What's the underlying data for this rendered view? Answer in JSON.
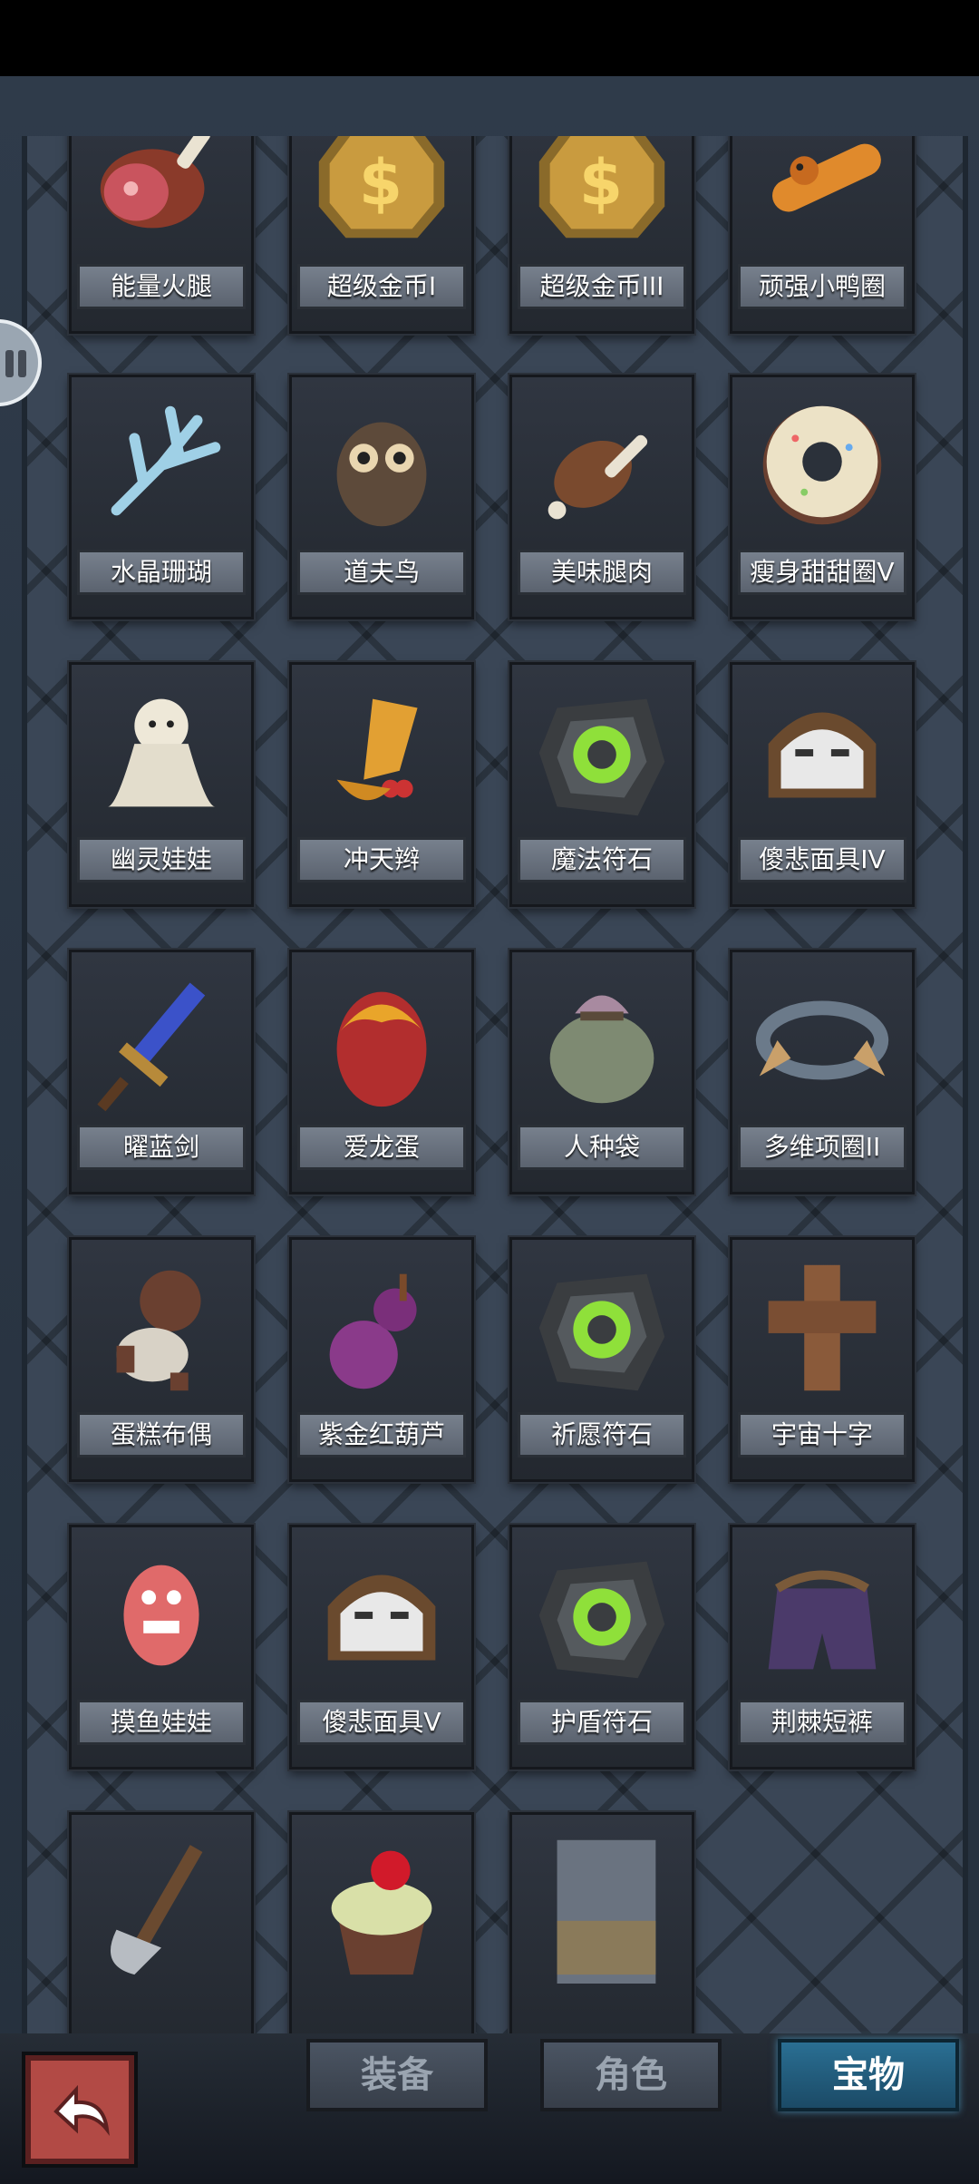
{
  "items": [
    {
      "name": "能量火腿",
      "icon": "ham-icon"
    },
    {
      "name": "超级金币I",
      "icon": "gold-coin-icon"
    },
    {
      "name": "超级金币III",
      "icon": "gold-coin-icon"
    },
    {
      "name": "顽强小鸭圈",
      "icon": "duck-ring-icon"
    },
    {
      "name": "水晶珊瑚",
      "icon": "crystal-coral-icon"
    },
    {
      "name": "道夫鸟",
      "icon": "owl-icon"
    },
    {
      "name": "美味腿肉",
      "icon": "drumstick-icon"
    },
    {
      "name": "瘦身甜甜圈V",
      "icon": "donut-icon"
    },
    {
      "name": "幽灵娃娃",
      "icon": "ghost-doll-icon"
    },
    {
      "name": "冲天辫",
      "icon": "ponytail-icon"
    },
    {
      "name": "魔法符石",
      "icon": "rune-stone-icon"
    },
    {
      "name": "傻悲面具IV",
      "icon": "mask-icon"
    },
    {
      "name": "曜蓝剑",
      "icon": "sword-icon"
    },
    {
      "name": "爱龙蛋",
      "icon": "dragon-egg-icon"
    },
    {
      "name": "人种袋",
      "icon": "sack-icon"
    },
    {
      "name": "多维项圈II",
      "icon": "collar-icon"
    },
    {
      "name": "蛋糕布偶",
      "icon": "cake-doll-icon"
    },
    {
      "name": "紫金红葫芦",
      "icon": "gourd-icon"
    },
    {
      "name": "祈愿符石",
      "icon": "rune-stone-icon"
    },
    {
      "name": "宇宙十字",
      "icon": "cross-icon"
    },
    {
      "name": "摸鱼娃娃",
      "icon": "fish-doll-icon"
    },
    {
      "name": "傻悲面具V",
      "icon": "mask-icon"
    },
    {
      "name": "护盾符石",
      "icon": "rune-stone-icon"
    },
    {
      "name": "荆棘短裤",
      "icon": "thorn-shorts-icon"
    },
    {
      "name": "",
      "icon": "axe-icon"
    },
    {
      "name": "",
      "icon": "cupcake-icon"
    },
    {
      "name": "",
      "icon": "armor-icon"
    }
  ],
  "tabs": [
    {
      "label": "装备",
      "active": false
    },
    {
      "label": "角色",
      "active": false
    },
    {
      "label": "宝物",
      "active": true
    }
  ],
  "back_button_icon": "return-arrow-icon",
  "colors": {
    "frame": "#3a4656",
    "active_tab": "#2a6f93",
    "label_bg": "#6b7480"
  }
}
